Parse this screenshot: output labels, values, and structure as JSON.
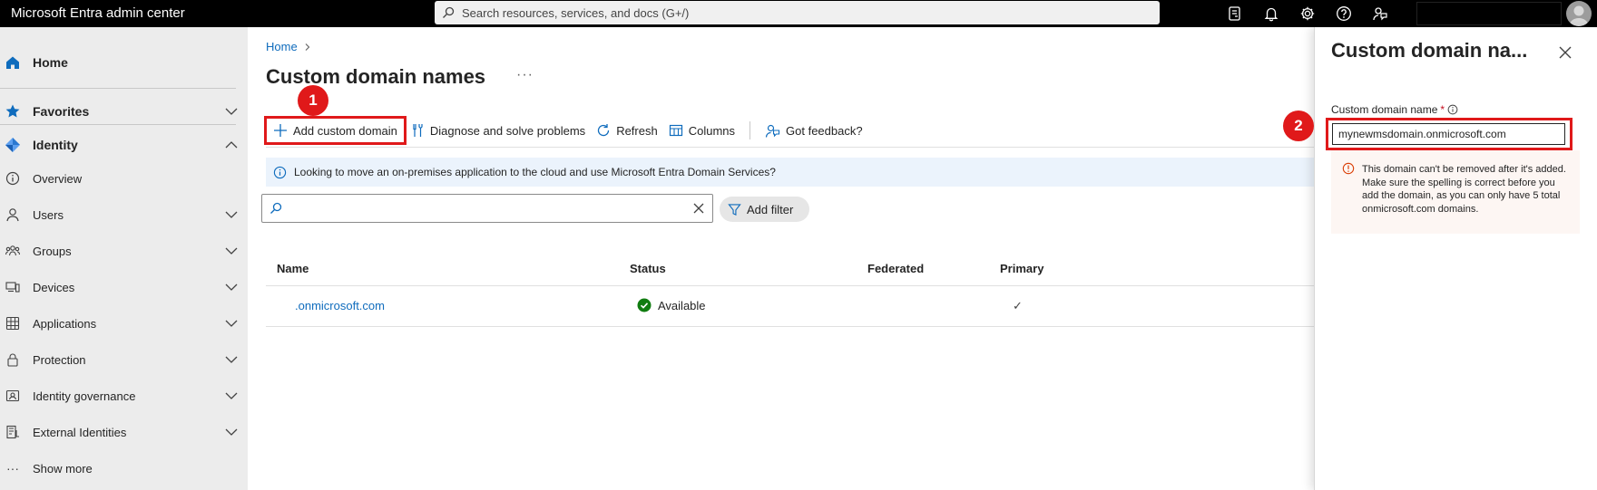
{
  "topbar": {
    "app_title": "Microsoft Entra admin center",
    "search_placeholder": "Search resources, services, and docs (G+/)"
  },
  "sidebar": {
    "home": "Home",
    "favorites": "Favorites",
    "identity": "Identity",
    "items": [
      {
        "label": "Overview",
        "icon": "info-icon",
        "expandable": false
      },
      {
        "label": "Users",
        "icon": "person-icon",
        "expandable": true
      },
      {
        "label": "Groups",
        "icon": "people-icon",
        "expandable": true
      },
      {
        "label": "Devices",
        "icon": "devices-icon",
        "expandable": true
      },
      {
        "label": "Applications",
        "icon": "apps-icon",
        "expandable": true
      },
      {
        "label": "Protection",
        "icon": "lock-icon",
        "expandable": true
      },
      {
        "label": "Identity governance",
        "icon": "governance-icon",
        "expandable": true
      },
      {
        "label": "External Identities",
        "icon": "external-icon",
        "expandable": true
      }
    ],
    "show_more": "Show more"
  },
  "main": {
    "breadcrumb": [
      "Home"
    ],
    "title": "Custom domain names",
    "more": "···",
    "commands": {
      "add": "Add custom domain",
      "diagnose": "Diagnose and solve problems",
      "refresh": "Refresh",
      "columns": "Columns",
      "feedback": "Got feedback?"
    },
    "info_text": "Looking to move an on-premises application to the cloud and use Microsoft Entra Domain Services?",
    "search_placeholder": "",
    "add_filter": "Add filter",
    "table": {
      "columns": [
        "Name",
        "Status",
        "Federated",
        "Primary"
      ],
      "rows": [
        {
          "name": ".onmicrosoft.com",
          "status": "Available",
          "federated": "",
          "primary": "✓"
        }
      ]
    }
  },
  "annotations": {
    "step1": "1",
    "step2": "2"
  },
  "panel": {
    "title": "Custom domain na...",
    "field_label": "Custom domain name",
    "required_marker": "*",
    "domain_value": "mynewmsdomain.onmicrosoft.com",
    "warning": "This domain can't be removed after it's added. Make sure the spelling is correct before you add the domain, as you can only have 5 total onmicrosoft.com domains."
  },
  "colors": {
    "accent": "#0f6cbd",
    "highlight": "#e0191a",
    "success": "#107c10",
    "warning": "#da3b01"
  }
}
